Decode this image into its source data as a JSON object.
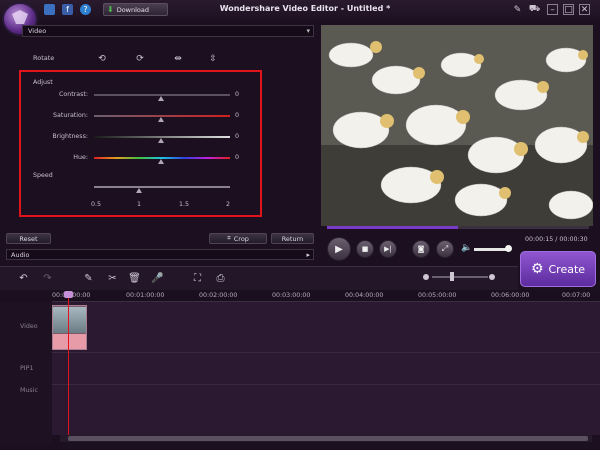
{
  "titlebar": {
    "title": "Wondershare Video Editor - Untitled *",
    "download_label": "Download"
  },
  "left_panel": {
    "mode_dropdown": "Video",
    "rotate_label": "Rotate",
    "adjust_label": "Adjust",
    "sliders": [
      {
        "label": "Contrast:",
        "value": "0",
        "fraction": 0.5
      },
      {
        "label": "Saturation:",
        "value": "0",
        "fraction": 0.5
      },
      {
        "label": "Brightness:",
        "value": "0",
        "fraction": 0.5
      },
      {
        "label": "Hue:",
        "value": "0",
        "fraction": 0.5
      }
    ],
    "speed": {
      "label": "Speed",
      "ticks": [
        "0.5",
        "1",
        "1.5",
        "2"
      ],
      "value": 1
    },
    "reset_label": "Reset",
    "crop_label": "Crop",
    "return_label": "Return",
    "audio_label": "Audio"
  },
  "preview": {
    "progress_fraction": 0.5,
    "time": "00:00:15 / 00:00:30",
    "volume_fraction": 0.9
  },
  "create_label": "Create",
  "timeline": {
    "ruler": [
      "00:00:00:00",
      "00:01:00:00",
      "00:02:00:00",
      "00:03:00:00",
      "00:04:00:00",
      "00:05:00:00",
      "00:06:00:00",
      "00:07:00"
    ],
    "tracks": [
      "Video",
      "PIP1",
      "Music"
    ]
  },
  "colors": {
    "accent": "#7a3cc8",
    "highlight_box": "#e0141a",
    "background": "#1c0f1f"
  }
}
